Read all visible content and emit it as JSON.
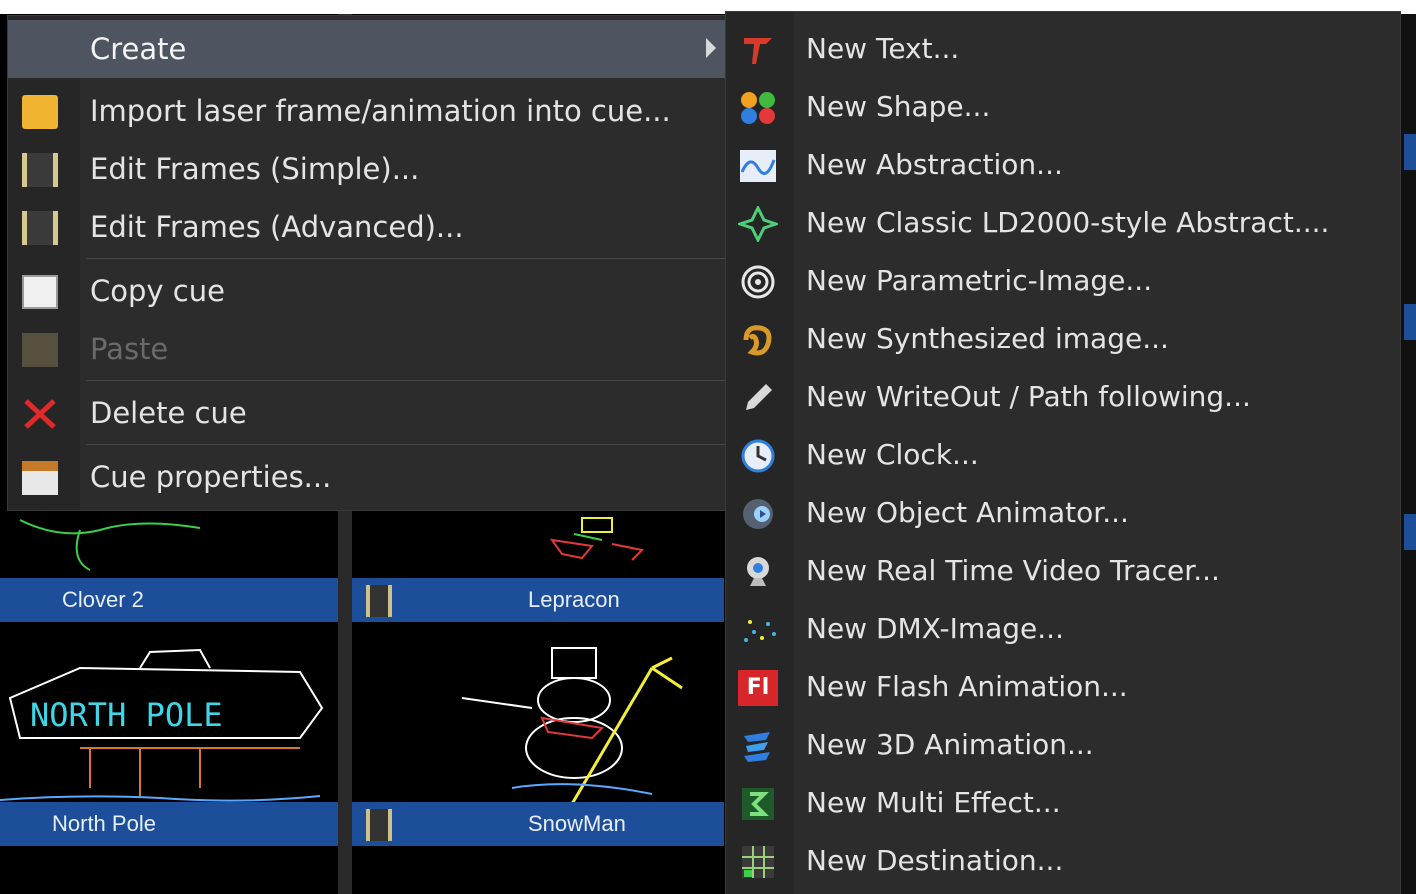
{
  "menu": {
    "items": [
      {
        "label": "Create",
        "icon": "create-icon",
        "highlighted": true,
        "has_submenu": true
      },
      {
        "label": "Import laser frame/animation into cue...",
        "icon": "folder-icon"
      },
      {
        "label": "Edit Frames (Simple)...",
        "icon": "film-frames-icon"
      },
      {
        "label": "Edit Frames (Advanced)...",
        "icon": "film-frames-icon"
      },
      {
        "label": "Copy cue",
        "icon": "copy-icon"
      },
      {
        "label": "Paste",
        "icon": "paste-icon",
        "disabled": true
      },
      {
        "label": "Delete cue",
        "icon": "scissors-delete-icon"
      },
      {
        "label": "Cue properties...",
        "icon": "properties-icon"
      }
    ]
  },
  "submenu": {
    "items": [
      {
        "label": "New Text...",
        "icon": "text-icon"
      },
      {
        "label": "New Shape...",
        "icon": "shape-icon"
      },
      {
        "label": "New Abstraction...",
        "icon": "abstraction-icon"
      },
      {
        "label": "New Classic LD2000-style Abstract....",
        "icon": "classic-abstract-icon"
      },
      {
        "label": "New Parametric-Image...",
        "icon": "parametric-image-icon"
      },
      {
        "label": "New Synthesized image...",
        "icon": "synthesized-image-icon"
      },
      {
        "label": "New WriteOut / Path following...",
        "icon": "pen-icon"
      },
      {
        "label": "New Clock...",
        "icon": "clock-icon"
      },
      {
        "label": "New Object Animator...",
        "icon": "object-animator-icon"
      },
      {
        "label": "New Real Time Video Tracer...",
        "icon": "webcam-icon"
      },
      {
        "label": "New DMX-Image...",
        "icon": "dmx-icon"
      },
      {
        "label": "New Flash Animation...",
        "icon": "flash-icon",
        "glyph": "Fl"
      },
      {
        "label": "New 3D Animation...",
        "icon": "3d-animation-icon"
      },
      {
        "label": "New Multi Effect...",
        "icon": "multi-effect-icon"
      },
      {
        "label": "New Destination...",
        "icon": "destination-icon"
      }
    ]
  },
  "cues": {
    "row1": [
      "Clover 2",
      "Lepracon"
    ],
    "row2": [
      "North Pole",
      "SnowMan"
    ],
    "north_pole_sign": "NORTH POLE"
  },
  "colors": {
    "menu_bg": "#2c2c2c",
    "highlight": "#4e5560",
    "cue_label_bg": "#1d4e9a",
    "laser_cyan": "#3fd6e6",
    "laser_yellow": "#f2ef3a"
  }
}
